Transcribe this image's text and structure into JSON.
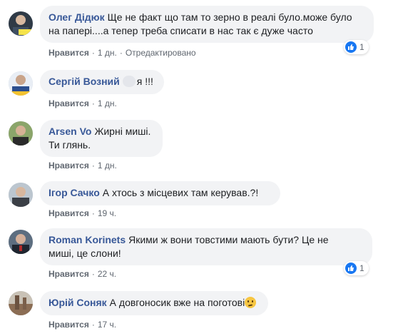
{
  "comments": [
    {
      "author": "Олег Дідюк",
      "text_line1": "Ще не факт що там то зерно в реалі було.може було",
      "text_line2": "на папері....а тепер треба списати в нас так є дуже часто",
      "like_label": "Нравится",
      "time": "1 дн.",
      "edited": "Отредактировано",
      "reaction_count": "1"
    },
    {
      "author": "Сергій Возний",
      "text": "я !!!",
      "like_label": "Нравится",
      "time": "1 дн."
    },
    {
      "author": "Arsen Vo",
      "text_line1": "Жирні миші.",
      "text_line2": "Ти глянь.",
      "like_label": "Нравится",
      "time": "1 дн."
    },
    {
      "author": "Ігор Сачко",
      "text": "А хтось з місцевих там керував.?!",
      "like_label": "Нравится",
      "time": "19 ч."
    },
    {
      "author": "Roman Korinets",
      "text_line1": "Якими ж вони товстими мають бути? Це не",
      "text_line2": "миші, це слони!",
      "like_label": "Нравится",
      "time": "22 ч.",
      "reaction_count": "1"
    },
    {
      "author": "Юрій Соняк",
      "text": "А довгоносик вже на поготові",
      "like_label": "Нравится",
      "time": "17 ч."
    }
  ],
  "separator": "·",
  "colors": {
    "author": "#385898",
    "bubble": "#f2f3f5",
    "like_blue": "#1877f2",
    "meta": "#606770"
  },
  "icons": {
    "reaction": "like-thumb-icon",
    "emoji_hidden": "obscured-emoji-icon",
    "emoji_think": "thinking-face-icon"
  }
}
